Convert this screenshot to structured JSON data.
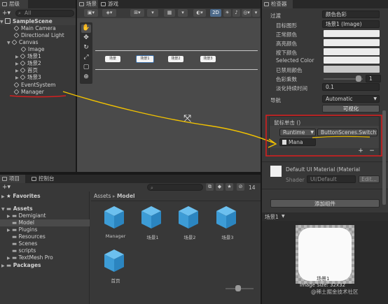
{
  "hierarchy": {
    "tab": "层级",
    "search_placeholder": "All",
    "scene": "SampleScene",
    "items": [
      "Main Camera",
      "Directional Light",
      "Canvas",
      "Image",
      "场景1",
      "场景2",
      "首页",
      "场景3",
      "EventSystem",
      "Manager"
    ]
  },
  "scene_view": {
    "tabs": [
      "场景",
      "游戏"
    ],
    "mode_2d": "2D",
    "scene_buttons": [
      "场景",
      "场景1",
      "场景2",
      "场景3"
    ]
  },
  "inspector": {
    "tab": "检查器",
    "transition_label": "过渡",
    "transition_value": "颜色色彩",
    "target_graphic_label": "目标图形",
    "target_graphic_value": "场景1 (Image)",
    "color_labels": [
      "正常颜色",
      "高亮颜色",
      "按下颜色",
      "Selected Color",
      "已禁用颜色"
    ],
    "color_multiplier_label": "色彩乘数",
    "color_multiplier_value": "1",
    "fade_duration_label": "淡化持续时间",
    "fade_duration_value": "0.1",
    "navigation_label": "导航",
    "navigation_value": "Automatic",
    "visualize_button": "可视化",
    "on_click_label": "鼠标单击 ()",
    "runtime_value": "Runtime",
    "function_value": "ButtonScenes.SwitchSc",
    "object_value": "Mana",
    "material_name": "Default UI Material (Material",
    "shader_label": "Shader",
    "shader_value": "UI/Default",
    "edit_button": "Edit...",
    "add_component_button": "添加组件",
    "preview_label": "场景1",
    "preview_caption": "场景1",
    "image_size": "Image Size: 32x32",
    "watermark": "@稀土掘金技术社区"
  },
  "project": {
    "tabs": [
      "项目",
      "控制台"
    ],
    "badge_count": "14",
    "favorites": "Favorites",
    "assets": "Assets",
    "folders": [
      "Demigiant",
      "Model",
      "Plugins",
      "Resources",
      "Scenes",
      "scripts",
      "TextMesh Pro"
    ],
    "packages": "Packages",
    "breadcrumb_root": "Assets",
    "breadcrumb_current": "Model",
    "asset_items": [
      "Manager",
      "场景1",
      "场景2",
      "场景3",
      "首页"
    ]
  },
  "colors": {
    "annotation_red": "#d42020",
    "annotation_yellow": "#f2c200",
    "asset_blue": "#4aa8e0",
    "selection": "#2c5d87"
  }
}
